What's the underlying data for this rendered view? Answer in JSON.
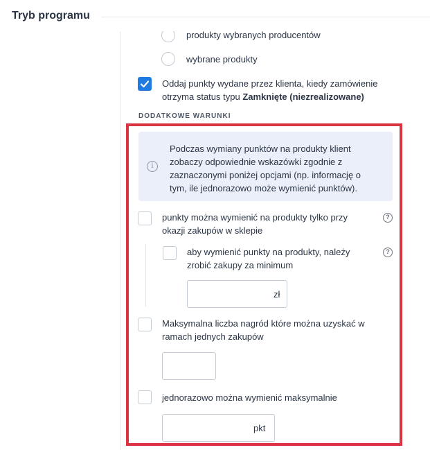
{
  "section": {
    "title": "Tryb programu"
  },
  "radios": [
    {
      "label": "produkty wybranych producentów"
    },
    {
      "label": "wybrane produkty"
    }
  ],
  "return_points": {
    "checked": true,
    "text_before": "Oddaj punkty wydane przez klienta, kiedy zamówienie otrzyma status typu ",
    "text_bold": "Zamknięte (niezrealizowane)"
  },
  "additional": {
    "caption": "DODATKOWE WARUNKI",
    "info_text": "Podczas wymiany punktów na produkty klient zobaczy odpowiednie wskazówki zgodnie z zaznaczonymi poniżej opcjami (np. informację o tym, ile jednorazowo może wymienić punktów).",
    "info_icon_glyph": "i",
    "only_with_purchase": {
      "label": "punkty można wymienić na produkty tylko przy okazji zakupów w sklepie",
      "checked": false
    },
    "minimum_purchase": {
      "label": "aby wymienić punkty na produkty, należy zrobić zakupy za minimum",
      "checked": false,
      "value": "",
      "unit": "zł"
    },
    "max_rewards": {
      "label": "Maksymalna liczba nagród które można uzyskać w ramach jednych zakupów",
      "checked": false,
      "value": ""
    },
    "max_points": {
      "label": "jednorazowo można wymienić maksymalnie",
      "checked": false,
      "value": "",
      "unit": "pkt"
    },
    "help_glyph": "?"
  },
  "colors": {
    "accent": "#1f7be0",
    "highlight": "#d9343f",
    "info_bg": "#eaeff9"
  }
}
